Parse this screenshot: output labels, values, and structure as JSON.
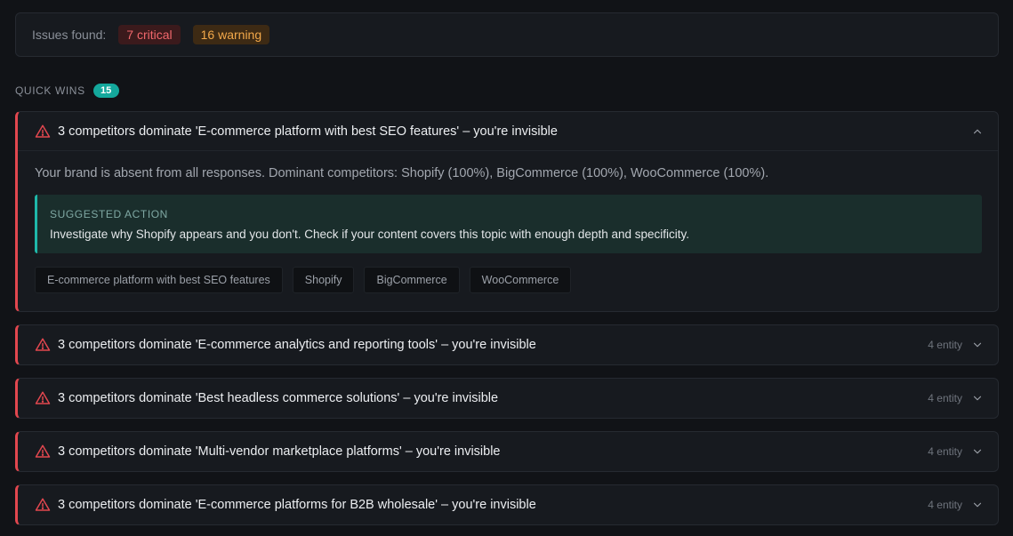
{
  "summary": {
    "label": "Issues found:",
    "critical": "7 critical",
    "warning": "16 warning"
  },
  "quick_wins": {
    "title": "QUICK WINS",
    "count": "15"
  },
  "expanded_issue": {
    "title": "3 competitors dominate 'E-commerce platform with best SEO features' – you're invisible",
    "description": "Your brand is absent from all responses. Dominant competitors: Shopify (100%), BigCommerce (100%), WooCommerce (100%).",
    "action_label": "SUGGESTED ACTION",
    "action_text": "Investigate why Shopify appears and you don't. Check if your content covers this topic with enough depth and specificity.",
    "tags": [
      "E-commerce platform with best SEO features",
      "Shopify",
      "BigCommerce",
      "WooCommerce"
    ]
  },
  "collapsed_issues": [
    {
      "title": "3 competitors dominate 'E-commerce analytics and reporting tools' – you're invisible",
      "meta": "4 entity"
    },
    {
      "title": "3 competitors dominate 'Best headless commerce solutions' – you're invisible",
      "meta": "4 entity"
    },
    {
      "title": "3 competitors dominate 'Multi-vendor marketplace platforms' – you're invisible",
      "meta": "4 entity"
    },
    {
      "title": "3 competitors dominate 'E-commerce platforms for B2B wholesale' – you're invisible",
      "meta": "4 entity"
    }
  ],
  "colors": {
    "critical": "#e2474f",
    "warning": "#f2a84a",
    "accent": "#14a89c"
  }
}
